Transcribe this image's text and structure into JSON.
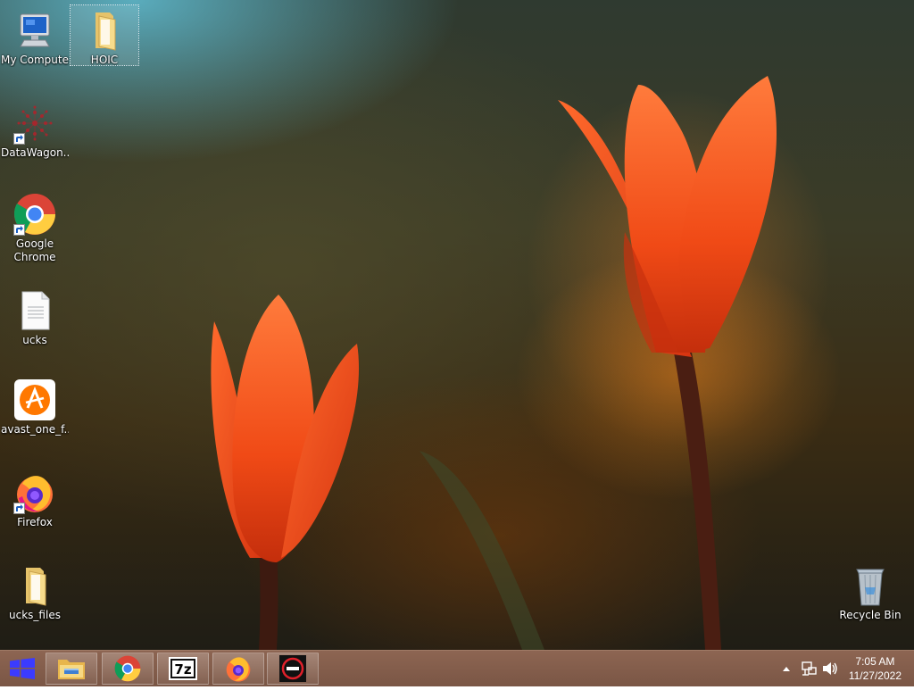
{
  "desktop_icons": [
    {
      "name": "my-computer",
      "label": "My Computer",
      "icon": "computer-icon"
    },
    {
      "name": "hoic",
      "label": "HOIC",
      "icon": "folder-icon",
      "selected": true
    },
    {
      "name": "datawagon",
      "label": "DataWagon...",
      "icon": "datawagon-icon",
      "shortcut": true
    },
    {
      "name": "google-chrome",
      "label": "Google Chrome",
      "icon": "chrome-icon",
      "shortcut": true
    },
    {
      "name": "ucks",
      "label": "ucks",
      "icon": "text-file-icon"
    },
    {
      "name": "avast",
      "label": "avast_one_f...",
      "icon": "avast-icon"
    },
    {
      "name": "firefox",
      "label": "Firefox",
      "icon": "firefox-icon",
      "shortcut": true
    },
    {
      "name": "ucks-files",
      "label": "ucks_files",
      "icon": "folder-icon"
    },
    {
      "name": "recycle-bin",
      "label": "Recycle Bin",
      "icon": "recycle-bin-icon"
    }
  ],
  "taskbar": {
    "start_icon": "windows-logo-icon",
    "pinned": [
      {
        "name": "file-explorer",
        "icon": "file-explorer-icon"
      },
      {
        "name": "chrome",
        "icon": "chrome-icon"
      },
      {
        "name": "7zip",
        "icon": "7zip-icon",
        "text": "7z"
      },
      {
        "name": "firefox",
        "icon": "firefox-icon"
      },
      {
        "name": "app",
        "icon": "minus-circle-icon"
      }
    ],
    "tray": {
      "icons": [
        "show-hidden-icons-arrow",
        "network-icon",
        "volume-icon"
      ],
      "time": "7:05 AM",
      "date": "11/27/2022"
    }
  },
  "colors": {
    "taskbar": "#7f5a48",
    "start_logo": "#3b3bff",
    "tulip": "#f0501a"
  }
}
